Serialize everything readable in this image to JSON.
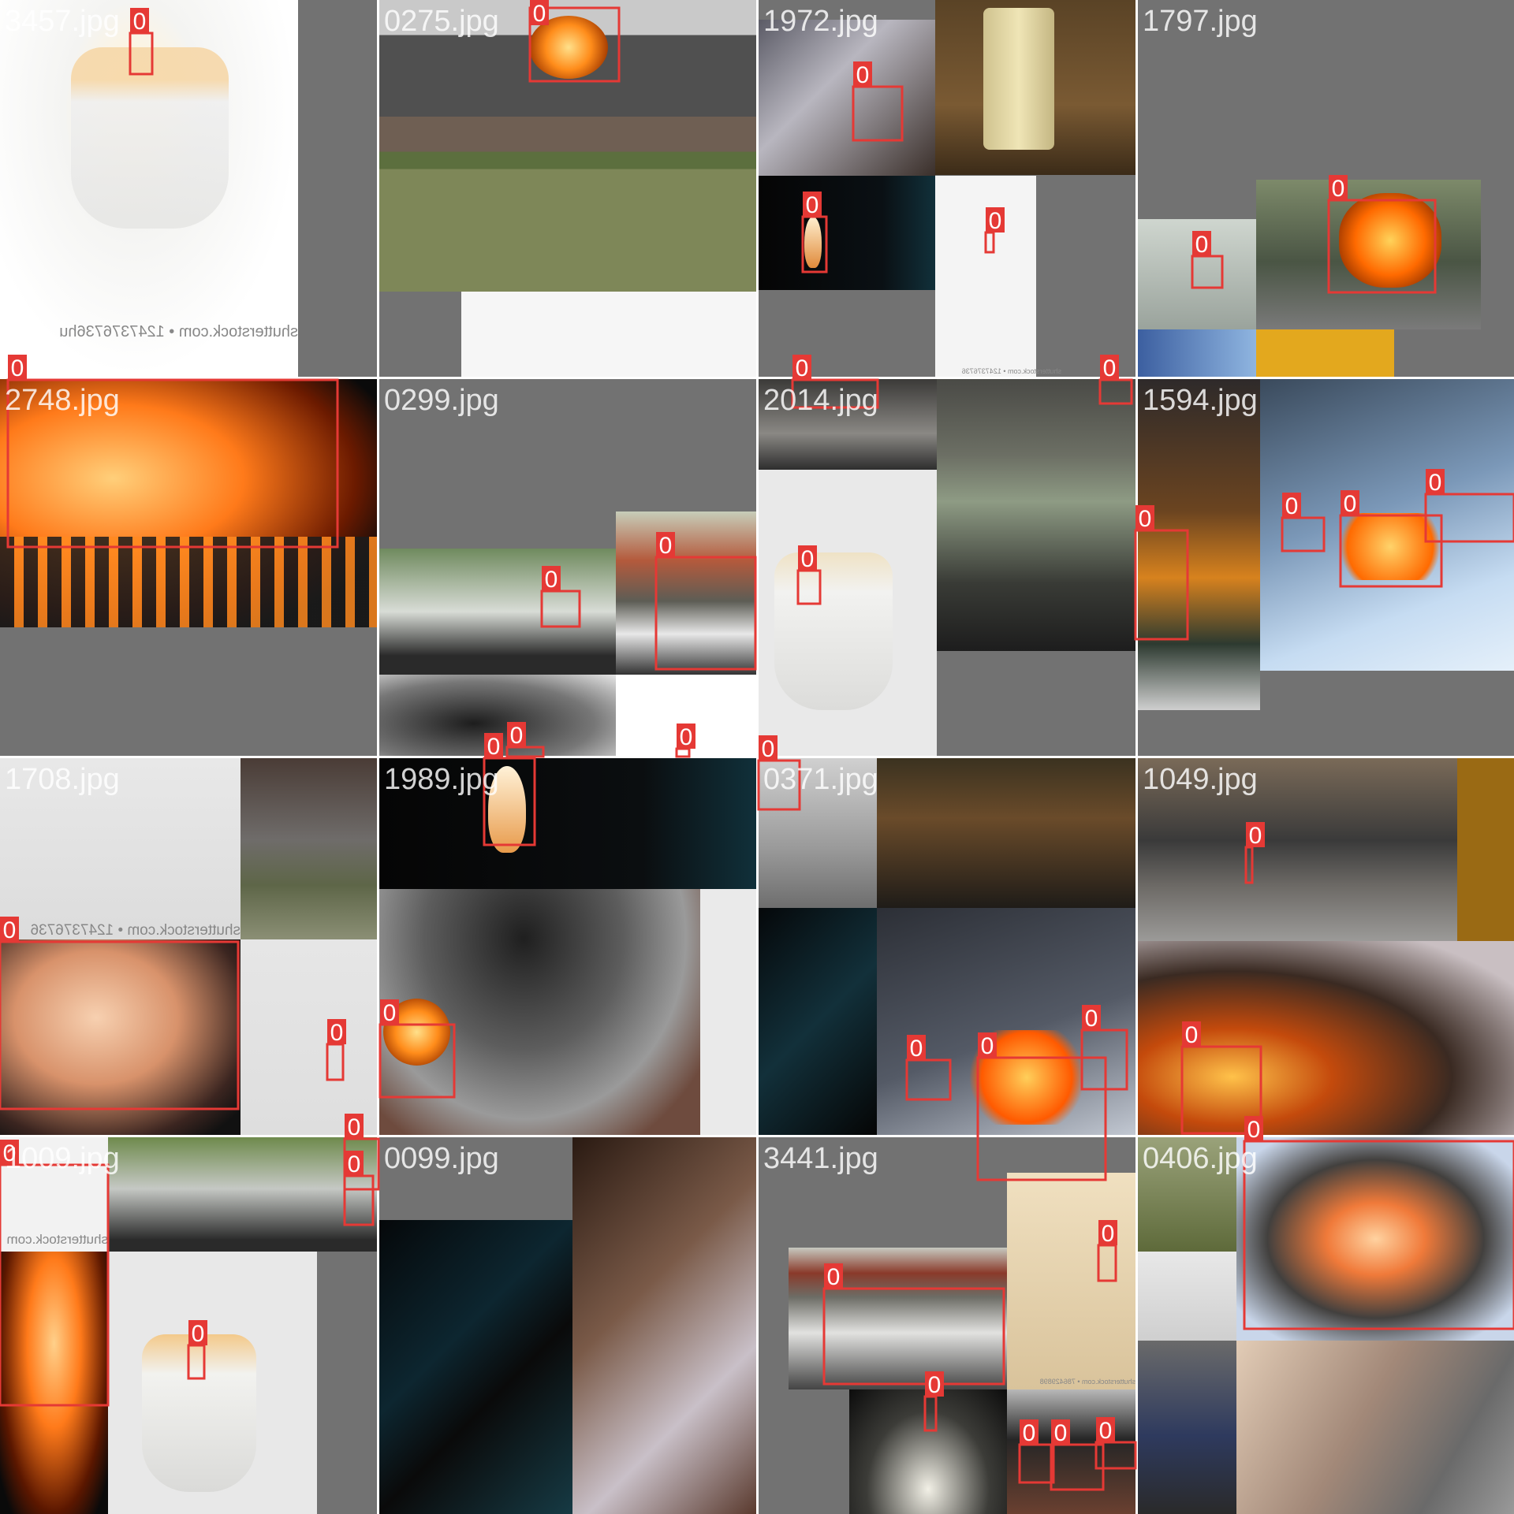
{
  "mosaic": {
    "label_class": "0",
    "box_color": "#e53935",
    "tiles": [
      {
        "file": "3457.jpg"
      },
      {
        "file": "0275.jpg"
      },
      {
        "file": "1972.jpg"
      },
      {
        "file": "1797.jpg"
      },
      {
        "file": "2748.jpg"
      },
      {
        "file": "0299.jpg"
      },
      {
        "file": "2014.jpg"
      },
      {
        "file": "1594.jpg"
      },
      {
        "file": "1708.jpg"
      },
      {
        "file": "1989.jpg"
      },
      {
        "file": "0371.jpg"
      },
      {
        "file": "1049.jpg"
      },
      {
        "file": "1009.jpg"
      },
      {
        "file": "0099.jpg"
      },
      {
        "file": "3441.jpg"
      },
      {
        "file": "0406.jpg"
      }
    ],
    "watermarks": [
      {
        "text": "shutterstock.com • 1247376736hu"
      },
      {
        "text": "shutterstock.com • 1247376736"
      },
      {
        "text": "shutterstock.com • 1247376736"
      },
      {
        "text": "shutterstock.com"
      },
      {
        "text": "shutterstock.com • 786429898"
      }
    ]
  }
}
